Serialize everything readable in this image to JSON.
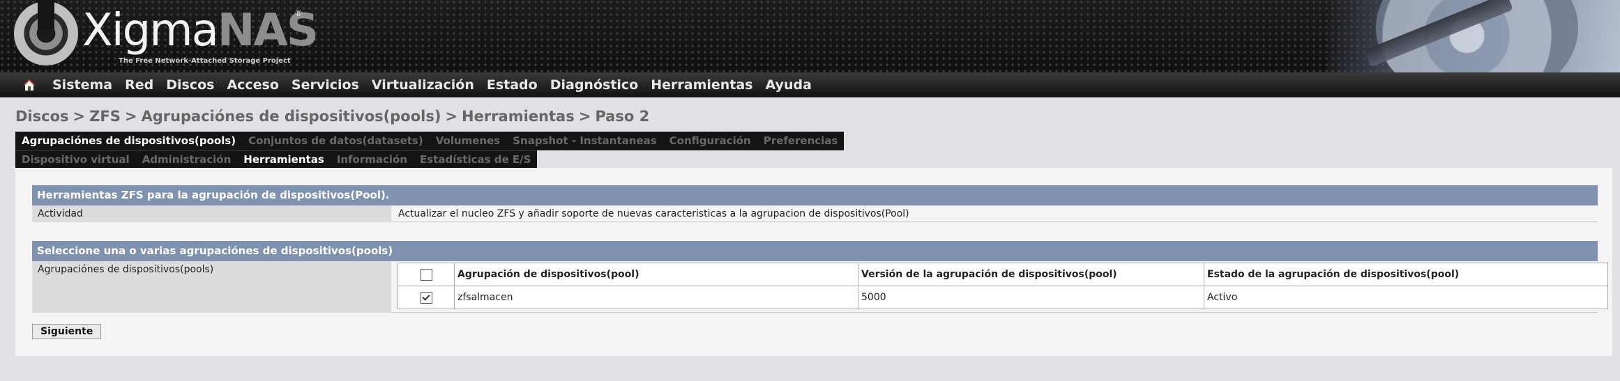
{
  "header": {
    "logo_main": "Xigma",
    "logo_accent": "NAS",
    "logo_reg": "®",
    "tagline": "The Free Network-Attached Storage Project"
  },
  "nav": {
    "home_icon": "home-icon",
    "items": [
      "Sistema",
      "Red",
      "Discos",
      "Acceso",
      "Servicios",
      "Virtualización",
      "Estado",
      "Diagnóstico",
      "Herramientas",
      "Ayuda"
    ]
  },
  "breadcrumb": {
    "parts": [
      "Discos",
      "ZFS",
      "Agrupaciónes de dispositivos(pools)",
      "Herramientas",
      "Paso 2"
    ],
    "separator": ">"
  },
  "tabs_primary": [
    {
      "label": "Agrupaciónes de dispositivos(pools)",
      "active": true
    },
    {
      "label": "Conjuntos de datos(datasets)",
      "active": false
    },
    {
      "label": "Volumenes",
      "active": false
    },
    {
      "label": "Snapshot - Instantaneas",
      "active": false
    },
    {
      "label": "Configuración",
      "active": false
    },
    {
      "label": "Preferencias",
      "active": false
    }
  ],
  "tabs_secondary": [
    {
      "label": "Dispositivo virtual",
      "active": false
    },
    {
      "label": "Administración",
      "active": false
    },
    {
      "label": "Herramientas",
      "active": true
    },
    {
      "label": "Información",
      "active": false
    },
    {
      "label": "Estadísticas de E/S",
      "active": false
    }
  ],
  "section1": {
    "title": "Herramientas ZFS para la agrupación de dispositivos(Pool).",
    "label": "Actividad",
    "value": "Actualizar el nucleo ZFS y añadir soporte de nuevas caracteristicas a la agrupacion de dispositivos(Pool)"
  },
  "section2": {
    "title": "Seleccione una o varias agrupaciónes de dispositivos(pools)",
    "label": "Agrupaciónes de dispositivos(pools)",
    "columns": [
      "Agrupación de dispositivos(pool)",
      "Versión de la agrupación de dispositivos(pool)",
      "Estado de la agrupación de dispositivos(pool)"
    ],
    "header_checked": false,
    "rows": [
      {
        "checked": true,
        "pool": "zfsalmacen",
        "version": "5000",
        "state": "Activo"
      }
    ]
  },
  "next_button": "Siguiente",
  "colors": {
    "section_header": "#7f93b0",
    "nav_bg": "#1a1a1a",
    "page_bg": "#dfe1e5"
  }
}
